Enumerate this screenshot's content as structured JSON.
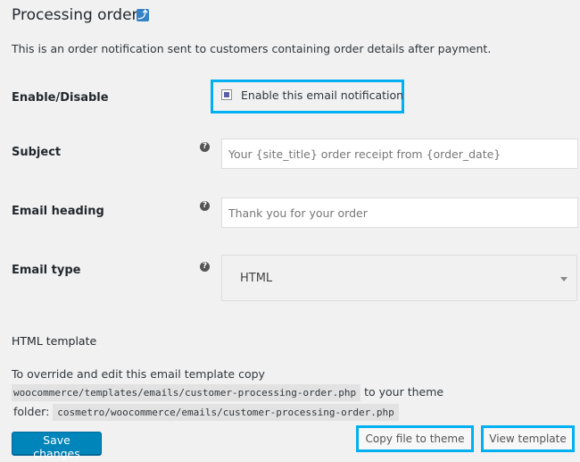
{
  "header": {
    "title": "Processing order",
    "back_icon": "up-arrow-icon",
    "description": "This is an order notification sent to customers containing order details after payment."
  },
  "fields": {
    "enable": {
      "label": "Enable/Disable",
      "checkbox_label": "Enable this email notification",
      "checked": true
    },
    "subject": {
      "label": "Subject",
      "value": "",
      "placeholder": "Your {site_title} order receipt from {order_date}",
      "help_icon": "question-icon"
    },
    "heading": {
      "label": "Email heading",
      "value": "",
      "placeholder": "Thank you for your order",
      "help_icon": "question-icon"
    },
    "email_type": {
      "label": "Email type",
      "selected": "HTML",
      "help_icon": "question-icon"
    }
  },
  "template": {
    "heading": "HTML template",
    "intro": "To override and edit this email template copy",
    "source_path": "woocommerce/templates/emails/customer-processing-order.php",
    "to_theme": "to your theme",
    "folder_label": "folder:",
    "dest_path": "cosmetro/woocommerce/emails/customer-processing-order.php"
  },
  "actions": {
    "save": "Save changes",
    "copy": "Copy file to theme",
    "view": "View template"
  },
  "colors": {
    "highlight": "#00b0f0",
    "primary": "#0085ba",
    "background": "#f1f1f1"
  }
}
